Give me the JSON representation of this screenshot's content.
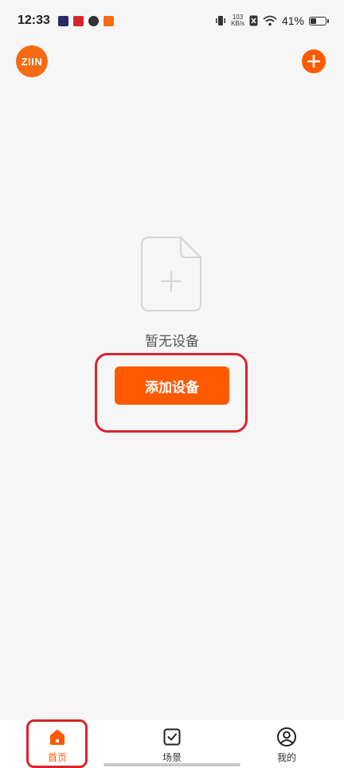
{
  "status_bar": {
    "time": "12:33",
    "net_speed_value": "103",
    "net_speed_unit": "KB/s",
    "battery_text": "41%",
    "battery_level": 0.41
  },
  "header": {
    "logo_text": "ZIIN"
  },
  "empty_state": {
    "message": "暂无设备",
    "add_button_label": "添加设备"
  },
  "nav": {
    "items": [
      {
        "label": "首页",
        "icon": "home-icon",
        "active": true
      },
      {
        "label": "场景",
        "icon": "scene-checkbox-icon",
        "active": false
      },
      {
        "label": "我的",
        "icon": "profile-icon",
        "active": false
      }
    ]
  },
  "colors": {
    "accent": "#ff5a00",
    "highlight": "#d9232d"
  }
}
